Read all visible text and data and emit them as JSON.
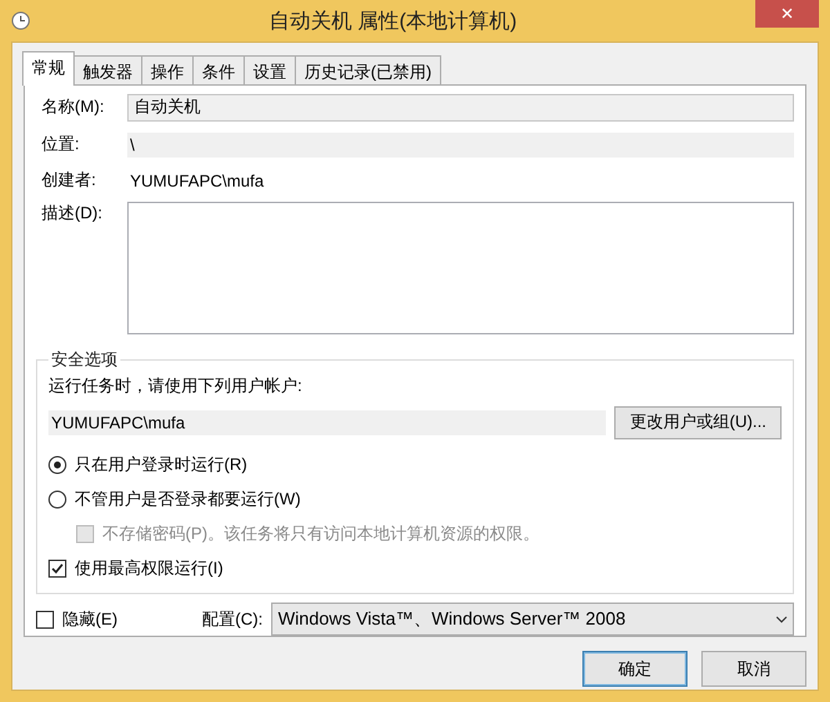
{
  "window": {
    "title": "自动关机 属性(本地计算机)",
    "close": "✕"
  },
  "tabs": [
    {
      "label": "常规",
      "selected": true
    },
    {
      "label": "触发器",
      "selected": false
    },
    {
      "label": "操作",
      "selected": false
    },
    {
      "label": "条件",
      "selected": false
    },
    {
      "label": "设置",
      "selected": false
    },
    {
      "label": "历史记录(已禁用)",
      "selected": false
    }
  ],
  "general": {
    "name_label": "名称(M):",
    "name_value": "自动关机",
    "location_label": "位置:",
    "location_value": "\\",
    "author_label": "创建者:",
    "author_value": "YUMUFAPC\\mufa",
    "description_label": "描述(D):"
  },
  "security": {
    "title": "安全选项",
    "account_prompt": "运行任务时，请使用下列用户帐户:",
    "account_value": "YUMUFAPC\\mufa",
    "change_button": "更改用户或组(U)...",
    "options": [
      {
        "kind": "radio",
        "label": "只在用户登录时运行(R)",
        "checked": true,
        "disabled": false
      },
      {
        "kind": "radio",
        "label": "不管用户是否登录都要运行(W)",
        "checked": false,
        "disabled": false,
        "children": [
          {
            "kind": "checkbox",
            "label": "不存储密码(P)。该任务将只有访问本地计算机资源的权限。",
            "checked": false,
            "disabled": true
          }
        ]
      },
      {
        "kind": "checkbox",
        "label": "使用最高权限运行(I)",
        "checked": true,
        "disabled": false
      }
    ]
  },
  "hidden": {
    "label": "隐藏(E)",
    "checked": false
  },
  "config": {
    "label": "配置(C):",
    "value": "Windows Vista™、Windows Server™ 2008"
  },
  "buttons": [
    {
      "label": "确定",
      "default": true
    },
    {
      "label": "取消",
      "default": false
    }
  ]
}
